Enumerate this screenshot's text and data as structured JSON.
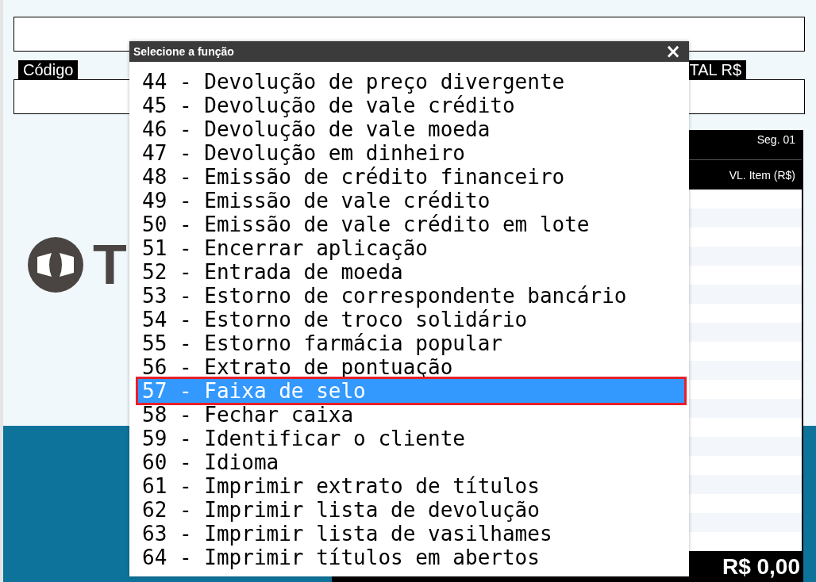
{
  "form": {
    "code_label": "Código",
    "total_label": "TAL R$"
  },
  "logo": {
    "text": "T"
  },
  "items_panel": {
    "segment": "Seg. 01",
    "column_value": "VL. Item (R$)",
    "total": "R$ 0,00"
  },
  "dialog": {
    "title": "Selecione a função",
    "close": "×",
    "items": [
      {
        "label": "44 - Devolução de preço divergente",
        "selected": false
      },
      {
        "label": "45 - Devolução de vale crédito",
        "selected": false
      },
      {
        "label": "46 - Devolução de vale moeda",
        "selected": false
      },
      {
        "label": "47 - Devolução em dinheiro",
        "selected": false
      },
      {
        "label": "48 - Emissão de crédito financeiro",
        "selected": false
      },
      {
        "label": "49 - Emissão de vale crédito",
        "selected": false
      },
      {
        "label": "50 - Emissão de vale crédito em lote",
        "selected": false
      },
      {
        "label": "51 - Encerrar aplicação",
        "selected": false
      },
      {
        "label": "52 - Entrada de moeda",
        "selected": false
      },
      {
        "label": "53 - Estorno de correspondente bancário",
        "selected": false
      },
      {
        "label": "54 - Estorno de troco solidário",
        "selected": false
      },
      {
        "label": "55 - Estorno farmácia popular",
        "selected": false
      },
      {
        "label": "56 - Extrato de pontuação",
        "selected": false
      },
      {
        "label": "57 - Faixa de selo",
        "selected": true
      },
      {
        "label": "58 - Fechar caixa",
        "selected": false
      },
      {
        "label": "59 - Identificar o cliente",
        "selected": false
      },
      {
        "label": "60 - Idioma",
        "selected": false
      },
      {
        "label": "61 - Imprimir extrato de títulos",
        "selected": false
      },
      {
        "label": "62 - Imprimir lista de devolução",
        "selected": false
      },
      {
        "label": "63 - Imprimir lista de vasilhames",
        "selected": false
      },
      {
        "label": "64 - Imprimir títulos em abertos",
        "selected": false
      }
    ]
  }
}
